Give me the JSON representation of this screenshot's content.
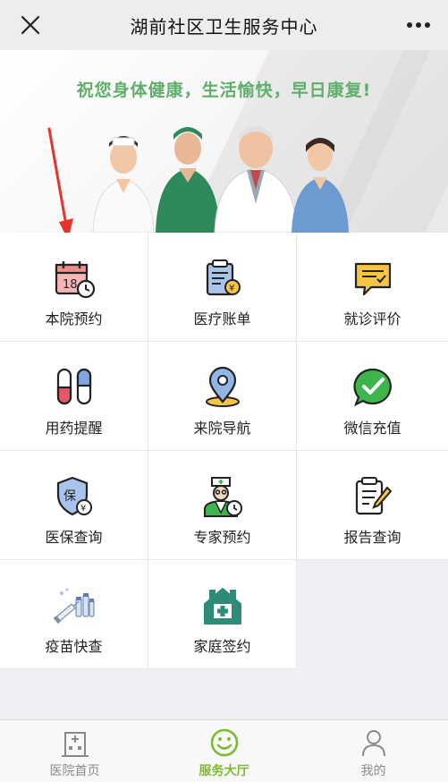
{
  "topbar": {
    "title": "湖前社区卫生服务中心",
    "close_icon": "close-icon",
    "more_icon": "more-icon"
  },
  "banner": {
    "slogan": "祝您身体健康，生活愉快，早日康复!"
  },
  "services": [
    {
      "label": "本院预约",
      "icon": "calendar-clock-icon"
    },
    {
      "label": "医疗账单",
      "icon": "bill-icon"
    },
    {
      "label": "就诊评价",
      "icon": "comment-icon"
    },
    {
      "label": "用药提醒",
      "icon": "pill-icon"
    },
    {
      "label": "来院导航",
      "icon": "location-pin-icon"
    },
    {
      "label": "微信充值",
      "icon": "wechat-icon"
    },
    {
      "label": "医保查询",
      "icon": "shield-icon"
    },
    {
      "label": "专家预约",
      "icon": "doctor-icon"
    },
    {
      "label": "报告查询",
      "icon": "report-icon"
    },
    {
      "label": "疫苗快查",
      "icon": "vaccine-icon"
    },
    {
      "label": "家庭签约",
      "icon": "family-home-icon"
    }
  ],
  "bottom_nav": [
    {
      "label": "医院首页",
      "icon": "hospital-icon",
      "active": false
    },
    {
      "label": "服务大厅",
      "icon": "smile-icon",
      "active": true
    },
    {
      "label": "我的",
      "icon": "person-icon",
      "active": false
    }
  ],
  "colors": {
    "accent": "#7dbb2e",
    "slogan": "#5fae6a",
    "arrow": "#e8322b"
  }
}
